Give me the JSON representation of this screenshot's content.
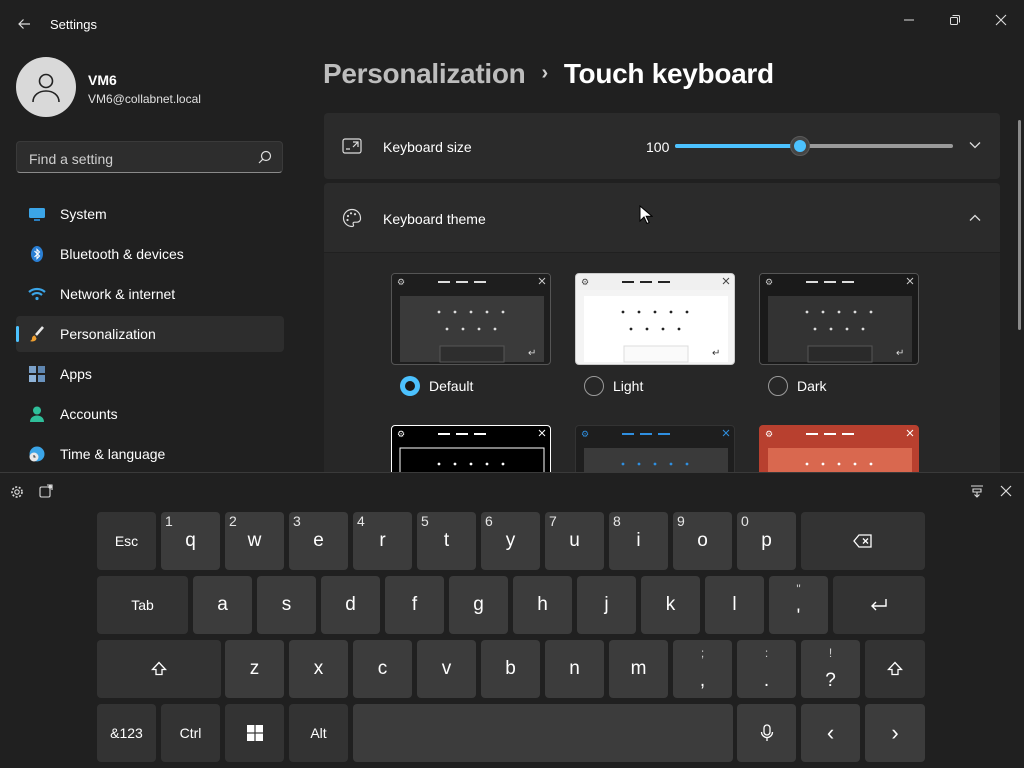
{
  "window": {
    "title": "Settings"
  },
  "user": {
    "name": "VM6",
    "email": "VM6@collabnet.local"
  },
  "search": {
    "placeholder": "Find a setting"
  },
  "nav": [
    {
      "label": "System",
      "icon": "monitor-icon"
    },
    {
      "label": "Bluetooth & devices",
      "icon": "bluetooth-icon"
    },
    {
      "label": "Network & internet",
      "icon": "wifi-icon"
    },
    {
      "label": "Personalization",
      "icon": "paintbrush-icon",
      "active": true
    },
    {
      "label": "Apps",
      "icon": "apps-icon"
    },
    {
      "label": "Accounts",
      "icon": "person-icon"
    },
    {
      "label": "Time & language",
      "icon": "globe-clock-icon"
    }
  ],
  "breadcrumb": {
    "parent": "Personalization",
    "separator": "›",
    "current": "Touch keyboard"
  },
  "keyboard_size": {
    "label": "Keyboard size",
    "value": "100",
    "fraction": 0.45
  },
  "keyboard_theme": {
    "label": "Keyboard theme",
    "selected": "Default",
    "options": [
      {
        "label": "Default",
        "style": "default"
      },
      {
        "label": "Light",
        "style": "light"
      },
      {
        "label": "Dark",
        "style": "dark"
      },
      {
        "label": "",
        "style": "high-contrast"
      },
      {
        "label": "",
        "style": "blue"
      },
      {
        "label": "",
        "style": "red"
      }
    ]
  },
  "colors": {
    "accent": "#4cc2ff",
    "background": "#202020",
    "card": "#2b2b2b",
    "key": "#3c3c3c",
    "function_key": "#333333"
  },
  "keyboard": {
    "row1": [
      {
        "label": "Esc"
      },
      {
        "main": "q",
        "num": "1"
      },
      {
        "main": "w",
        "num": "2"
      },
      {
        "main": "e",
        "num": "3"
      },
      {
        "main": "r",
        "num": "4"
      },
      {
        "main": "t",
        "num": "5"
      },
      {
        "main": "y",
        "num": "6"
      },
      {
        "main": "u",
        "num": "7"
      },
      {
        "main": "i",
        "num": "8"
      },
      {
        "main": "o",
        "num": "9"
      },
      {
        "main": "p",
        "num": "0"
      },
      {
        "icon": "backspace-icon"
      }
    ],
    "row2": [
      {
        "label": "Tab"
      },
      {
        "main": "a"
      },
      {
        "main": "s"
      },
      {
        "main": "d"
      },
      {
        "main": "f"
      },
      {
        "main": "g"
      },
      {
        "main": "h"
      },
      {
        "main": "j"
      },
      {
        "main": "k"
      },
      {
        "main": "l"
      },
      {
        "alt": "\"",
        "low": "'"
      },
      {
        "icon": "enter-icon"
      }
    ],
    "row3": [
      {
        "icon": "shift-icon"
      },
      {
        "main": "z"
      },
      {
        "main": "x"
      },
      {
        "main": "c"
      },
      {
        "main": "v"
      },
      {
        "main": "b"
      },
      {
        "main": "n"
      },
      {
        "main": "m"
      },
      {
        "alt": ";",
        "low": ","
      },
      {
        "alt": ":",
        "low": "."
      },
      {
        "alt": "!",
        "low": "?"
      },
      {
        "icon": "shift-icon"
      }
    ],
    "row4": [
      {
        "label": "&123"
      },
      {
        "label": "Ctrl"
      },
      {
        "icon": "windows-icon"
      },
      {
        "label": "Alt"
      },
      {
        "icon": "space"
      },
      {
        "icon": "microphone-icon"
      },
      {
        "label": "‹"
      },
      {
        "label": "›"
      }
    ]
  }
}
